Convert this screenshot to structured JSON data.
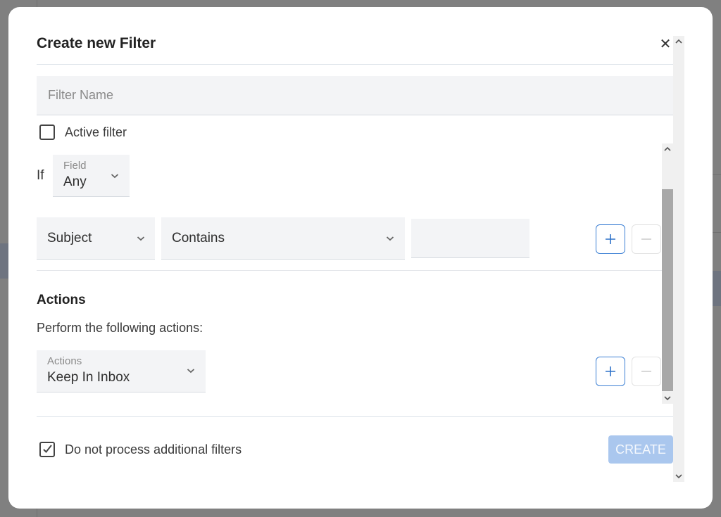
{
  "dialog": {
    "title": "Create new Filter",
    "close_icon": "close-icon"
  },
  "filter_name": {
    "placeholder": "Filter Name",
    "value": ""
  },
  "active_filter": {
    "label": "Active filter",
    "checked": false
  },
  "condition": {
    "if_label": "If",
    "field_select": {
      "label": "Field",
      "value": "Any"
    },
    "subject_select": {
      "value": "Subject"
    },
    "operator_select": {
      "value": "Contains"
    },
    "value_input": {
      "value": ""
    },
    "add_icon": "plus-icon",
    "remove_icon": "minus-icon"
  },
  "actions": {
    "heading": "Actions",
    "subheading": "Perform the following actions:",
    "action_select": {
      "label": "Actions",
      "value": "Keep In Inbox"
    }
  },
  "footer": {
    "no_additional_label": "Do not process additional filters",
    "no_additional_checked": true,
    "create_label": "CREATE"
  },
  "colors": {
    "accent": "#2e72c9",
    "create_disabled": "#aac7ee",
    "field_bg": "#f3f4f6",
    "overlay": "#808080"
  }
}
